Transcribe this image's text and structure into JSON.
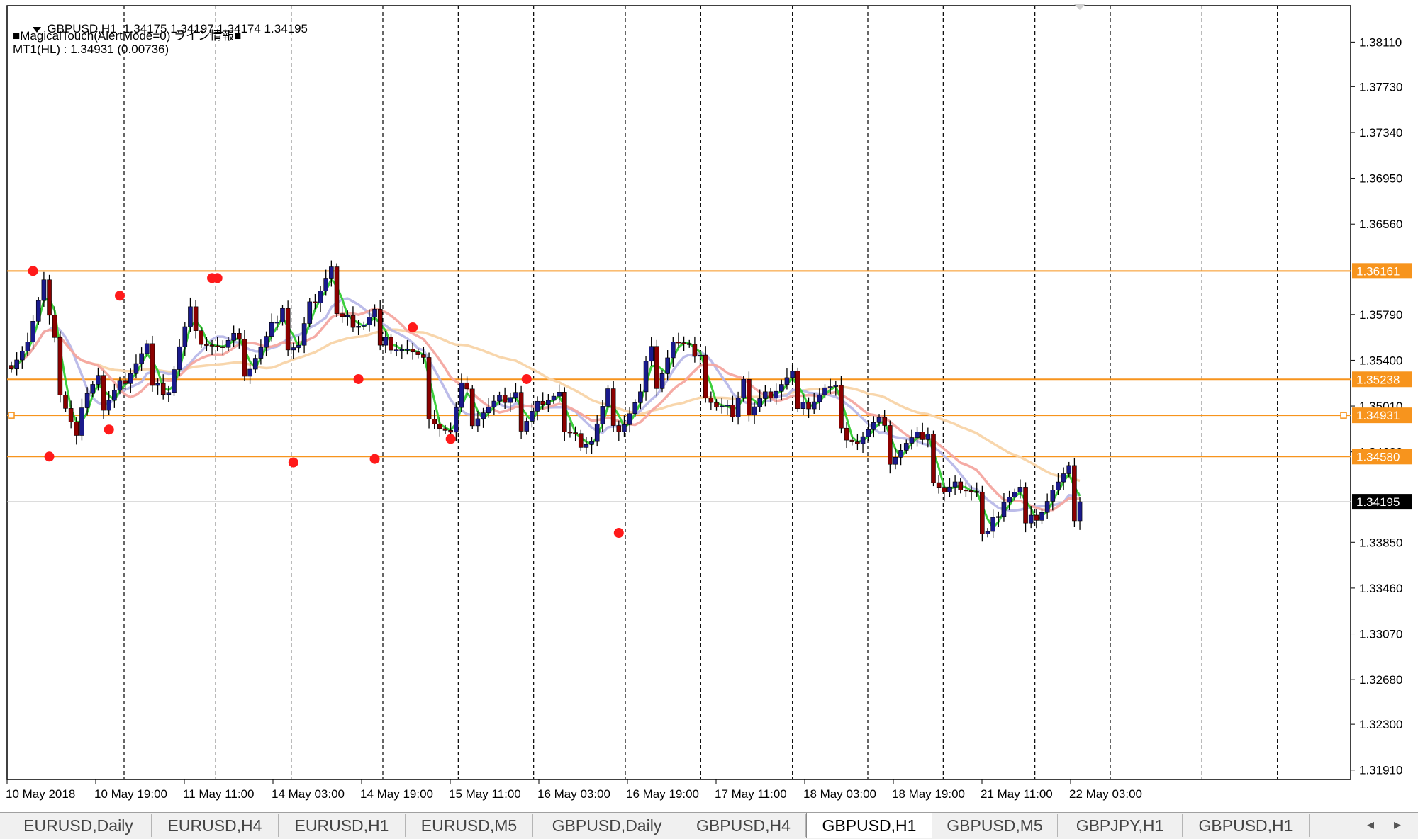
{
  "window": {
    "symbol_line": "GBPUSD,H1  1.34175 1.34197 1.34174 1.34195",
    "indicator_line": "■MagicalTouch(AlertMode=0) ライン情報■",
    "mt_line": "MT1(HL) : 1.34931 (0.00736)"
  },
  "chart_data": {
    "type": "candlestick",
    "symbol": "GBPUSD",
    "timeframe": "H1",
    "ohlc_current": {
      "open": 1.34175,
      "high": 1.34197,
      "low": 1.34174,
      "close": 1.34195
    },
    "ylim": [
      1.3183,
      1.3842
    ],
    "y_ticks": [
      "1.38110",
      "1.37730",
      "1.37340",
      "1.36950",
      "1.36560",
      "1.35790",
      "1.35400",
      "1.35010",
      "1.34620",
      "1.33850",
      "1.33460",
      "1.33070",
      "1.32680",
      "1.32300",
      "1.31910"
    ],
    "x_ticks": [
      "10 May 2018",
      "10 May 19:00",
      "11 May 11:00",
      "14 May 03:00",
      "14 May 19:00",
      "15 May 11:00",
      "16 May 03:00",
      "16 May 19:00",
      "17 May 11:00",
      "18 May 03:00",
      "18 May 19:00",
      "21 May 11:00",
      "22 May 03:00"
    ],
    "vertical_separators": 15,
    "horizontal_lines": [
      {
        "label": "1.36161",
        "value": 1.36161,
        "color": "#f7941d"
      },
      {
        "label": "1.35238",
        "value": 1.35238,
        "color": "#f7941d"
      },
      {
        "label": "1.34931",
        "value": 1.34931,
        "color": "#f7941d"
      },
      {
        "label": "1.34580",
        "value": 1.3458,
        "color": "#f7941d"
      }
    ],
    "bid_line": {
      "label": "1.34195",
      "value": 1.34195
    },
    "candle_count": 198,
    "candle_anchors": [
      [
        0,
        1.3555
      ],
      [
        4,
        1.356
      ],
      [
        7,
        1.3595
      ],
      [
        10,
        1.3545
      ],
      [
        14,
        1.3475
      ],
      [
        17,
        1.351
      ],
      [
        20,
        1.3515
      ],
      [
        25,
        1.3525
      ],
      [
        30,
        1.3535
      ],
      [
        34,
        1.3518
      ],
      [
        37,
        1.3545
      ],
      [
        40,
        1.3578
      ],
      [
        43,
        1.3565
      ],
      [
        47,
        1.3545
      ],
      [
        52,
        1.3545
      ],
      [
        56,
        1.3555
      ],
      [
        60,
        1.3572
      ],
      [
        63,
        1.356
      ],
      [
        66,
        1.3585
      ],
      [
        70,
        1.3602
      ],
      [
        73,
        1.3585
      ],
      [
        77,
        1.3565
      ],
      [
        82,
        1.3568
      ],
      [
        87,
        1.3545
      ],
      [
        91,
        1.352
      ],
      [
        94,
        1.349
      ],
      [
        96,
        1.3475
      ],
      [
        99,
        1.3505
      ],
      [
        103,
        1.3505
      ],
      [
        108,
        1.35
      ],
      [
        112,
        1.3495
      ],
      [
        117,
        1.3505
      ],
      [
        121,
        1.3495
      ],
      [
        125,
        1.3475
      ],
      [
        128,
        1.3468
      ],
      [
        131,
        1.3495
      ],
      [
        135,
        1.3495
      ],
      [
        138,
        1.3505
      ],
      [
        140,
        1.3525
      ],
      [
        143,
        1.3545
      ],
      [
        146,
        1.356
      ],
      [
        149,
        1.354
      ],
      [
        152,
        1.3525
      ],
      [
        155,
        1.3505
      ],
      [
        158,
        1.349
      ],
      [
        161,
        1.351
      ],
      [
        165,
        1.3513
      ],
      [
        170,
        1.3512
      ],
      [
        175,
        1.351
      ],
      [
        179,
        1.351
      ],
      [
        183,
        1.349
      ],
      [
        186,
        1.3475
      ],
      [
        189,
        1.3475
      ],
      [
        193,
        1.347
      ],
      [
        197,
        1.347
      ],
      [
        201,
        1.3465
      ],
      [
        205,
        1.3435
      ],
      [
        209,
        1.343
      ],
      [
        212,
        1.341
      ],
      [
        215,
        1.3402
      ],
      [
        218,
        1.342
      ],
      [
        222,
        1.3415
      ],
      [
        226,
        1.3418
      ],
      [
        229,
        1.3425
      ],
      [
        233,
        1.3428
      ],
      [
        236,
        1.3419
      ]
    ],
    "fractal_highs": [
      [
        5,
        1.36161
      ],
      [
        24,
        1.3595
      ],
      [
        44,
        1.361
      ],
      [
        45,
        1.361
      ],
      [
        88,
        1.3568
      ],
      [
        76,
        1.3524
      ],
      [
        113,
        1.3524
      ]
    ],
    "fractal_lows": [
      [
        8,
        1.3458
      ],
      [
        21,
        1.3481
      ],
      [
        62,
        1.3453
      ],
      [
        80,
        1.3456
      ],
      [
        96,
        1.3473
      ],
      [
        133,
        1.3393
      ]
    ],
    "series": [
      {
        "name": "",
        "color": "#33cc33",
        "smoothing": 3
      },
      {
        "name": "",
        "color": "#f4a6a0",
        "smoothing": 14
      },
      {
        "name": "",
        "color": "#b8b8e8",
        "smoothing": 8
      },
      {
        "name": "",
        "color": "#f8d4a8",
        "smoothing": 40
      }
    ]
  },
  "tabs": [
    {
      "label": "EURUSD,Daily",
      "active": false
    },
    {
      "label": "EURUSD,H4",
      "active": false
    },
    {
      "label": "EURUSD,H1",
      "active": false
    },
    {
      "label": "EURUSD,M5",
      "active": false
    },
    {
      "label": "GBPUSD,Daily",
      "active": false
    },
    {
      "label": "GBPUSD,H4",
      "active": false
    },
    {
      "label": "GBPUSD,H1",
      "active": true
    },
    {
      "label": "GBPUSD,M5",
      "active": false
    },
    {
      "label": "GBPJPY,H1",
      "active": false
    },
    {
      "label": "GBPUSD,H1",
      "active": false
    }
  ],
  "tab_scroll": {
    "left": "◂",
    "right": "▸"
  }
}
